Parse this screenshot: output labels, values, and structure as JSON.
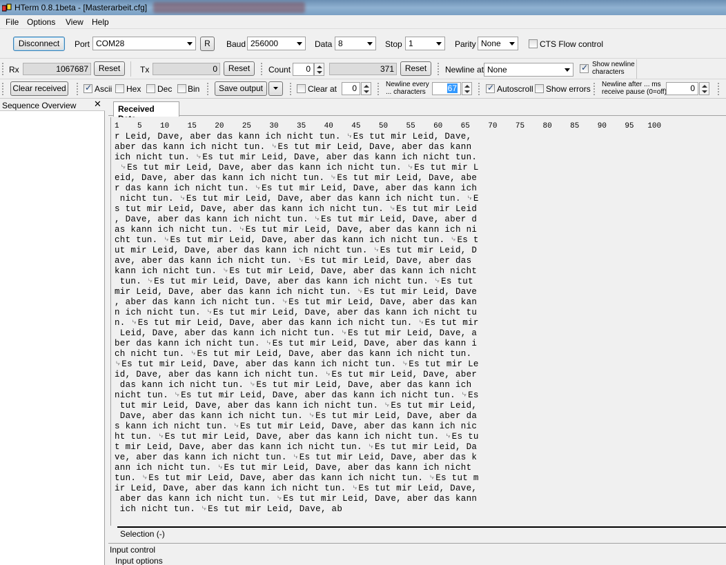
{
  "window": {
    "title": "HTerm 0.8.1beta - [Masterarbeit.cfg]"
  },
  "menu": [
    "File",
    "Options",
    "View",
    "Help"
  ],
  "connection": {
    "disconnect_label": "Disconnect",
    "port_label": "Port",
    "port_value": "COM28",
    "refresh_label": "R",
    "baud_label": "Baud",
    "baud_value": "256000",
    "data_label": "Data",
    "data_value": "8",
    "stop_label": "Stop",
    "stop_value": "1",
    "parity_label": "Parity",
    "parity_value": "None",
    "cts_label": "CTS Flow control",
    "cts_checked": false
  },
  "counters": {
    "rx_label": "Rx",
    "rx_value": "1067687",
    "rx_reset": "Reset",
    "tx_label": "Tx",
    "tx_value": "0",
    "tx_reset": "Reset",
    "count_label": "Count",
    "count_value": "0",
    "count_field": "371",
    "count_reset": "Reset",
    "newline_at_label": "Newline at",
    "newline_at_value": "None",
    "show_newline_label_1": "Show newline",
    "show_newline_label_2": "characters",
    "show_newline_checked": true
  },
  "display": {
    "clear_received": "Clear received",
    "ascii_label": "Ascii",
    "ascii_checked": true,
    "hex_label": "Hex",
    "dec_label": "Dec",
    "bin_label": "Bin",
    "save_output": "Save output",
    "clear_at_label": "Clear at",
    "clear_at_value": "0",
    "newline_every_1": "Newline every",
    "newline_every_2": "... characters",
    "newline_every_value": "67",
    "autoscroll_label": "Autoscroll",
    "autoscroll_checked": true,
    "show_errors_label": "Show errors",
    "newline_after_1": "Newline after ... ms",
    "newline_after_2": "receive pause (0=off)",
    "newline_after_value": "0"
  },
  "sidebar": {
    "title": "Sequence Overview",
    "close": "✕"
  },
  "tabs": {
    "received": "Received Data"
  },
  "received": {
    "ruler": "1    5    10    15    20    25    30    35    40    45    50    55    60    65    70    75    80    85    90    95   100",
    "lines": [
      "r Leid, Dave, aber das kann ich nicht tun. ␊Es tut mir Leid, Dave,",
      "aber das kann ich nicht tun. ␊Es tut mir Leid, Dave, aber das kann",
      "ich nicht tun. ␊Es tut mir Leid, Dave, aber das kann ich nicht tun.",
      " ␊Es tut mir Leid, Dave, aber das kann ich nicht tun. ␊Es tut mir L",
      "eid, Dave, aber das kann ich nicht tun. ␊Es tut mir Leid, Dave, abe",
      "r das kann ich nicht tun. ␊Es tut mir Leid, Dave, aber das kann ich",
      " nicht tun. ␊Es tut mir Leid, Dave, aber das kann ich nicht tun. ␊E",
      "s tut mir Leid, Dave, aber das kann ich nicht tun. ␊Es tut mir Leid",
      ", Dave, aber das kann ich nicht tun. ␊Es tut mir Leid, Dave, aber d",
      "as kann ich nicht tun. ␊Es tut mir Leid, Dave, aber das kann ich ni",
      "cht tun. ␊Es tut mir Leid, Dave, aber das kann ich nicht tun. ␊Es t",
      "ut mir Leid, Dave, aber das kann ich nicht tun. ␊Es tut mir Leid, D",
      "ave, aber das kann ich nicht tun. ␊Es tut mir Leid, Dave, aber das",
      "kann ich nicht tun. ␊Es tut mir Leid, Dave, aber das kann ich nicht",
      " tun. ␊Es tut mir Leid, Dave, aber das kann ich nicht tun. ␊Es tut",
      "mir Leid, Dave, aber das kann ich nicht tun. ␊Es tut mir Leid, Dave",
      ", aber das kann ich nicht tun. ␊Es tut mir Leid, Dave, aber das kan",
      "n ich nicht tun. ␊Es tut mir Leid, Dave, aber das kann ich nicht tu",
      "n. ␊Es tut mir Leid, Dave, aber das kann ich nicht tun. ␊Es tut mir",
      " Leid, Dave, aber das kann ich nicht tun. ␊Es tut mir Leid, Dave, a",
      "ber das kann ich nicht tun. ␊Es tut mir Leid, Dave, aber das kann i",
      "ch nicht tun. ␊Es tut mir Leid, Dave, aber das kann ich nicht tun.",
      "␊Es tut mir Leid, Dave, aber das kann ich nicht tun. ␊Es tut mir Le",
      "id, Dave, aber das kann ich nicht tun. ␊Es tut mir Leid, Dave, aber",
      " das kann ich nicht tun. ␊Es tut mir Leid, Dave, aber das kann ich",
      "nicht tun. ␊Es tut mir Leid, Dave, aber das kann ich nicht tun. ␊Es",
      " tut mir Leid, Dave, aber das kann ich nicht tun. ␊Es tut mir Leid,",
      " Dave, aber das kann ich nicht tun. ␊Es tut mir Leid, Dave, aber da",
      "s kann ich nicht tun. ␊Es tut mir Leid, Dave, aber das kann ich nic",
      "ht tun. ␊Es tut mir Leid, Dave, aber das kann ich nicht tun. ␊Es tu",
      "t mir Leid, Dave, aber das kann ich nicht tun. ␊Es tut mir Leid, Da",
      "ve, aber das kann ich nicht tun. ␊Es tut mir Leid, Dave, aber das k",
      "ann ich nicht tun. ␊Es tut mir Leid, Dave, aber das kann ich nicht",
      "tun. ␊Es tut mir Leid, Dave, aber das kann ich nicht tun. ␊Es tut m",
      "ir Leid, Dave, aber das kann ich nicht tun. ␊Es tut mir Leid, Dave,",
      " aber das kann ich nicht tun. ␊Es tut mir Leid, Dave, aber das kann",
      " ich nicht tun. ␊Es tut mir Leid, Dave, ab"
    ],
    "selection": "Selection (-)"
  },
  "input": {
    "control_title": "Input control",
    "options_title": "Input options"
  },
  "colors": {
    "titlebar": "#7aa0c4",
    "accent": "#3c7fb1",
    "highlight": "#3399ff"
  }
}
